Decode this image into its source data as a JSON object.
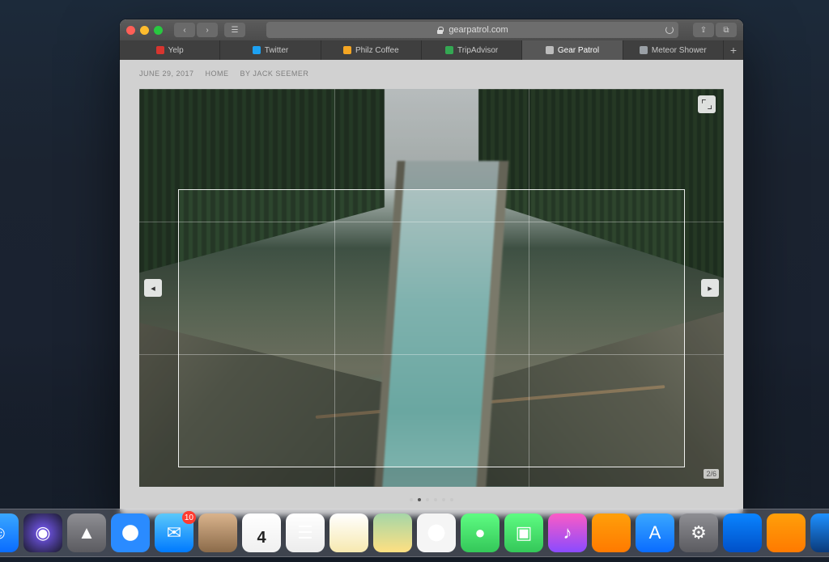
{
  "browser": {
    "url_display": "gearpatrol.com",
    "tabs": [
      {
        "label": "Yelp",
        "icon_color": "#d7352f",
        "active": false
      },
      {
        "label": "Twitter",
        "icon_color": "#1da1f2",
        "active": false
      },
      {
        "label": "Philz Coffee",
        "icon_color": "#f5a623",
        "active": false
      },
      {
        "label": "TripAdvisor",
        "icon_color": "#34a853",
        "active": false
      },
      {
        "label": "Gear Patrol",
        "icon_color": "#bcbcbc",
        "active": true
      },
      {
        "label": "Meteor Shower",
        "icon_color": "#9aa0a6",
        "active": false
      }
    ]
  },
  "article": {
    "date": "JUNE 29, 2017",
    "category": "HOME",
    "byline": "By JACK SEEMER",
    "slide_counter": "2/6",
    "dot_count": 6,
    "active_dot": 1
  },
  "dock": {
    "apps": [
      {
        "name": "finder",
        "bg": "linear-gradient(#3aa7ff,#0a6cff)",
        "glyph": "☺"
      },
      {
        "name": "siri",
        "bg": "radial-gradient(circle at 50% 50%,#7b5cff,#1a1a2a)",
        "glyph": "◉"
      },
      {
        "name": "launchpad",
        "bg": "linear-gradient(#8e8e93,#5b5b60)",
        "glyph": "▲"
      },
      {
        "name": "safari",
        "bg": "radial-gradient(circle,#fefefe 28%,#2a8bff 30%)",
        "glyph": ""
      },
      {
        "name": "mail",
        "bg": "linear-gradient(#5ac8fa,#007aff)",
        "glyph": "✉",
        "badge": "10"
      },
      {
        "name": "contacts",
        "bg": "linear-gradient(#d9b38c,#8b6b4a)",
        "glyph": ""
      },
      {
        "name": "calendar",
        "bg": "linear-gradient(#fff,#f0f0f0)",
        "day": "4"
      },
      {
        "name": "reminders",
        "bg": "linear-gradient(#fff,#ececec)",
        "glyph": "☰"
      },
      {
        "name": "notes",
        "bg": "linear-gradient(#fff,#f7e9b0)",
        "glyph": ""
      },
      {
        "name": "maps",
        "bg": "linear-gradient(#a5d6a7,#ffe082)",
        "glyph": ""
      },
      {
        "name": "photos",
        "bg": "radial-gradient(circle,#fff 30%,#f5f5f5 31%)",
        "glyph": "✿"
      },
      {
        "name": "messages",
        "bg": "linear-gradient(#5efc82,#34c759)",
        "glyph": "●"
      },
      {
        "name": "facetime",
        "bg": "linear-gradient(#5efc82,#34c759)",
        "glyph": "▣"
      },
      {
        "name": "itunes",
        "bg": "linear-gradient(#fb5bc5,#8a4bff)",
        "glyph": "♪"
      },
      {
        "name": "ibooks",
        "bg": "linear-gradient(#ff9f0a,#ff7a00)",
        "glyph": ""
      },
      {
        "name": "appstore",
        "bg": "linear-gradient(#3aa7ff,#0a6cff)",
        "glyph": "A"
      },
      {
        "name": "preferences",
        "bg": "linear-gradient(#8e8e93,#5b5b60)",
        "glyph": "⚙"
      },
      {
        "name": "keynote",
        "bg": "linear-gradient(#0a84ff,#0050c8)",
        "glyph": ""
      },
      {
        "name": "pages",
        "bg": "linear-gradient(#ff9f0a,#ff7a00)",
        "glyph": ""
      },
      {
        "name": "xcode",
        "bg": "linear-gradient(#1e90ff,#0a3a7a)",
        "glyph": ""
      }
    ]
  }
}
